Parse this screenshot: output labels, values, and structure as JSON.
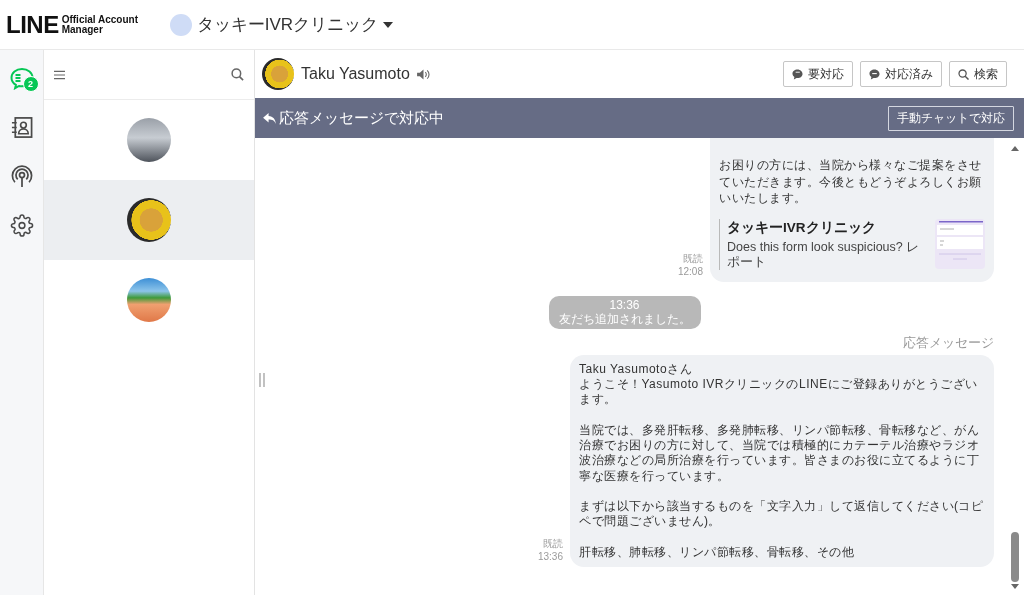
{
  "header": {
    "logo": {
      "wordmark": "LINE",
      "subtitle": "Official Account Manager"
    },
    "account": {
      "name": "タッキーIVRクリニック"
    }
  },
  "rail": [
    {
      "kind": "chats",
      "selected": true,
      "badge": "2"
    },
    {
      "kind": "contacts",
      "selected": false
    },
    {
      "kind": "broadcast",
      "selected": false
    },
    {
      "kind": "settings",
      "selected": false
    }
  ],
  "chat_list": {
    "items": [
      {
        "selected": false
      },
      {
        "selected": true
      },
      {
        "selected": false
      }
    ]
  },
  "chat": {
    "contact": {
      "name": "Taku Yasumoto"
    },
    "buttons": [
      {
        "kind": "pending",
        "label": "要対応"
      },
      {
        "kind": "done",
        "label": "対応済み"
      },
      {
        "kind": "search",
        "label": "検索"
      }
    ],
    "banner": {
      "status": "応答メッセージで対応中",
      "button": "手動チャットで対応"
    },
    "messages": [
      {
        "kind": "outgoing",
        "clipped": true,
        "read_status": "既読",
        "time": "12:08",
        "paragraphs": [
          [
            "お困りの方には、当院から様々なご提案をさせていただきます。今後ともどうぞよろしくお願いいたします。"
          ]
        ],
        "card": {
          "title": "タッキーIVRクリニック",
          "description": "Does this form look suspicious? レポート"
        }
      },
      {
        "kind": "system",
        "time": "13:36",
        "text": "友だち追加されました。"
      },
      {
        "kind": "outgoing",
        "clipped": false,
        "label": "応答メッセージ",
        "read_status": "既読",
        "time": "13:36",
        "paragraphs": [
          [
            "Taku Yasumotoさん",
            "ようこそ！Yasumoto IVRクリニックのLINEにご登録ありがとうございます。"
          ],
          [
            "当院では、多発肝転移、多発肺転移、リンパ節転移、骨転移など、がん治療でお困りの方に対して、当院では積極的にカテーテル治療やラジオ波治療などの局所治療を行っています。皆さまのお役に立てるように丁寧な医療を行っています。"
          ],
          [
            "まずは以下から該当するものを「文字入力」して返信してください(コピペで問題ございません)。"
          ],
          [
            "肝転移、肺転移、リンパ節転移、骨転移、その他"
          ]
        ]
      }
    ]
  }
}
